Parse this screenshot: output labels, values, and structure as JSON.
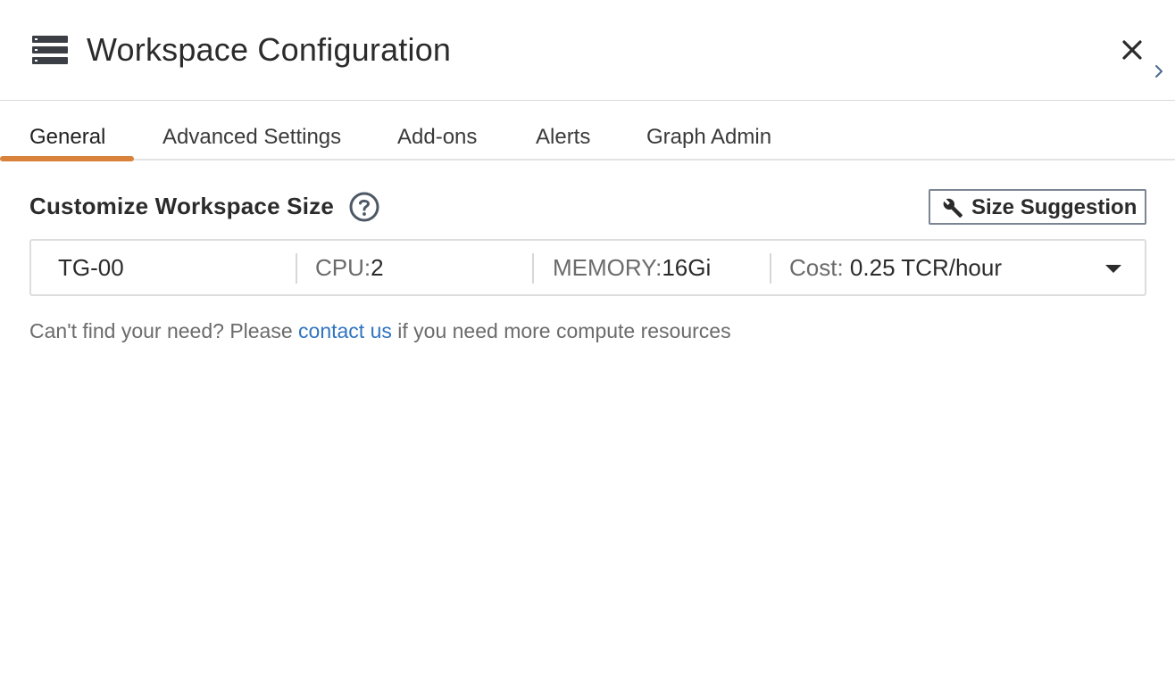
{
  "header": {
    "title": "Workspace Configuration",
    "menu_icon": "server-stack-icon",
    "close_icon": "close-icon",
    "collapse_icon": "chevron-right-icon"
  },
  "tabs": [
    {
      "label": "General",
      "active": true
    },
    {
      "label": "Advanced Settings",
      "active": false
    },
    {
      "label": "Add-ons",
      "active": false
    },
    {
      "label": "Alerts",
      "active": false
    },
    {
      "label": "Graph Admin",
      "active": false
    }
  ],
  "section": {
    "title": "Customize Workspace Size",
    "help_icon": "help-circle-icon",
    "suggestion_button": {
      "icon": "wrench-icon",
      "label": "Size Suggestion"
    }
  },
  "workspace_size": {
    "name": "TG-00",
    "cpu_label": "CPU:",
    "cpu_value": "2",
    "memory_label": "MEMORY:",
    "memory_value": "16Gi",
    "cost_label": "Cost:",
    "cost_value": "0.25 TCR/hour",
    "caret_icon": "caret-down-icon"
  },
  "help": {
    "prefix": "Can't find your need? Please ",
    "link": "contact us",
    "suffix": " if you need more compute resources"
  },
  "colors": {
    "accent": "#d9823b",
    "link": "#2f74c0",
    "text_primary": "#2b2b2b",
    "text_secondary": "#6b6b6b"
  }
}
